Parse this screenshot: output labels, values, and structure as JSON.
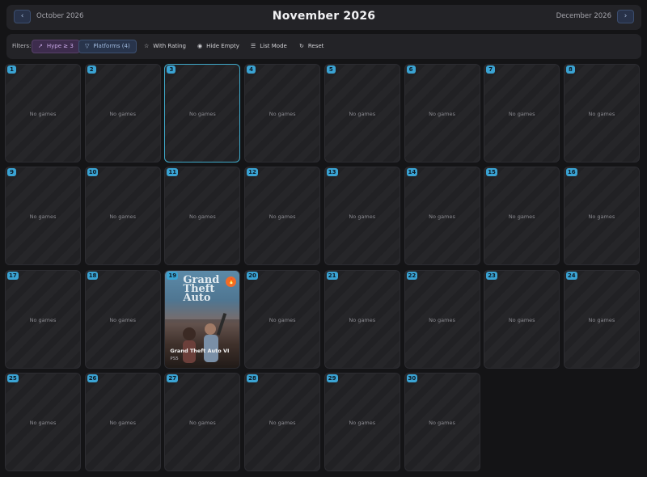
{
  "header": {
    "prev_label": "October 2026",
    "title": "November 2026",
    "next_label": "December 2026",
    "prev_icon": "chevron-left-icon",
    "next_icon": "chevron-right-icon"
  },
  "filters": {
    "label": "Filters:",
    "items": [
      {
        "label": "Hype ≥ 3",
        "icon": "trending-up-icon",
        "active": true
      },
      {
        "label": "Platforms (4)",
        "icon": "filter-icon",
        "active": true
      },
      {
        "label": "With Rating",
        "icon": "star-icon",
        "active": false
      },
      {
        "label": "Hide Empty",
        "icon": "eye-icon",
        "active": false
      },
      {
        "label": "List Mode",
        "icon": "list-icon",
        "active": false
      },
      {
        "label": "Reset",
        "icon": "reset-icon",
        "active": false
      }
    ]
  },
  "calendar": {
    "empty_label": "No games",
    "selected_day": 3,
    "days": [
      {
        "day": "1"
      },
      {
        "day": "2"
      },
      {
        "day": "3"
      },
      {
        "day": "4"
      },
      {
        "day": "5"
      },
      {
        "day": "6"
      },
      {
        "day": "7"
      },
      {
        "day": "8"
      },
      {
        "day": "9"
      },
      {
        "day": "10"
      },
      {
        "day": "11"
      },
      {
        "day": "12"
      },
      {
        "day": "13"
      },
      {
        "day": "14"
      },
      {
        "day": "15"
      },
      {
        "day": "16"
      },
      {
        "day": "17"
      },
      {
        "day": "18"
      },
      {
        "day": "19",
        "game": {
          "title": "Grand Theft Auto VI",
          "platform": "PS5"
        }
      },
      {
        "day": "20"
      },
      {
        "day": "21"
      },
      {
        "day": "22"
      },
      {
        "day": "23"
      },
      {
        "day": "24"
      },
      {
        "day": "25"
      },
      {
        "day": "26"
      },
      {
        "day": "27"
      },
      {
        "day": "28"
      },
      {
        "day": "29"
      },
      {
        "day": "30"
      }
    ]
  },
  "colors": {
    "accent": "#3aa3d3",
    "hype_chip": "#3d2c4d",
    "platform_chip": "#28344b",
    "background": "#141416"
  }
}
